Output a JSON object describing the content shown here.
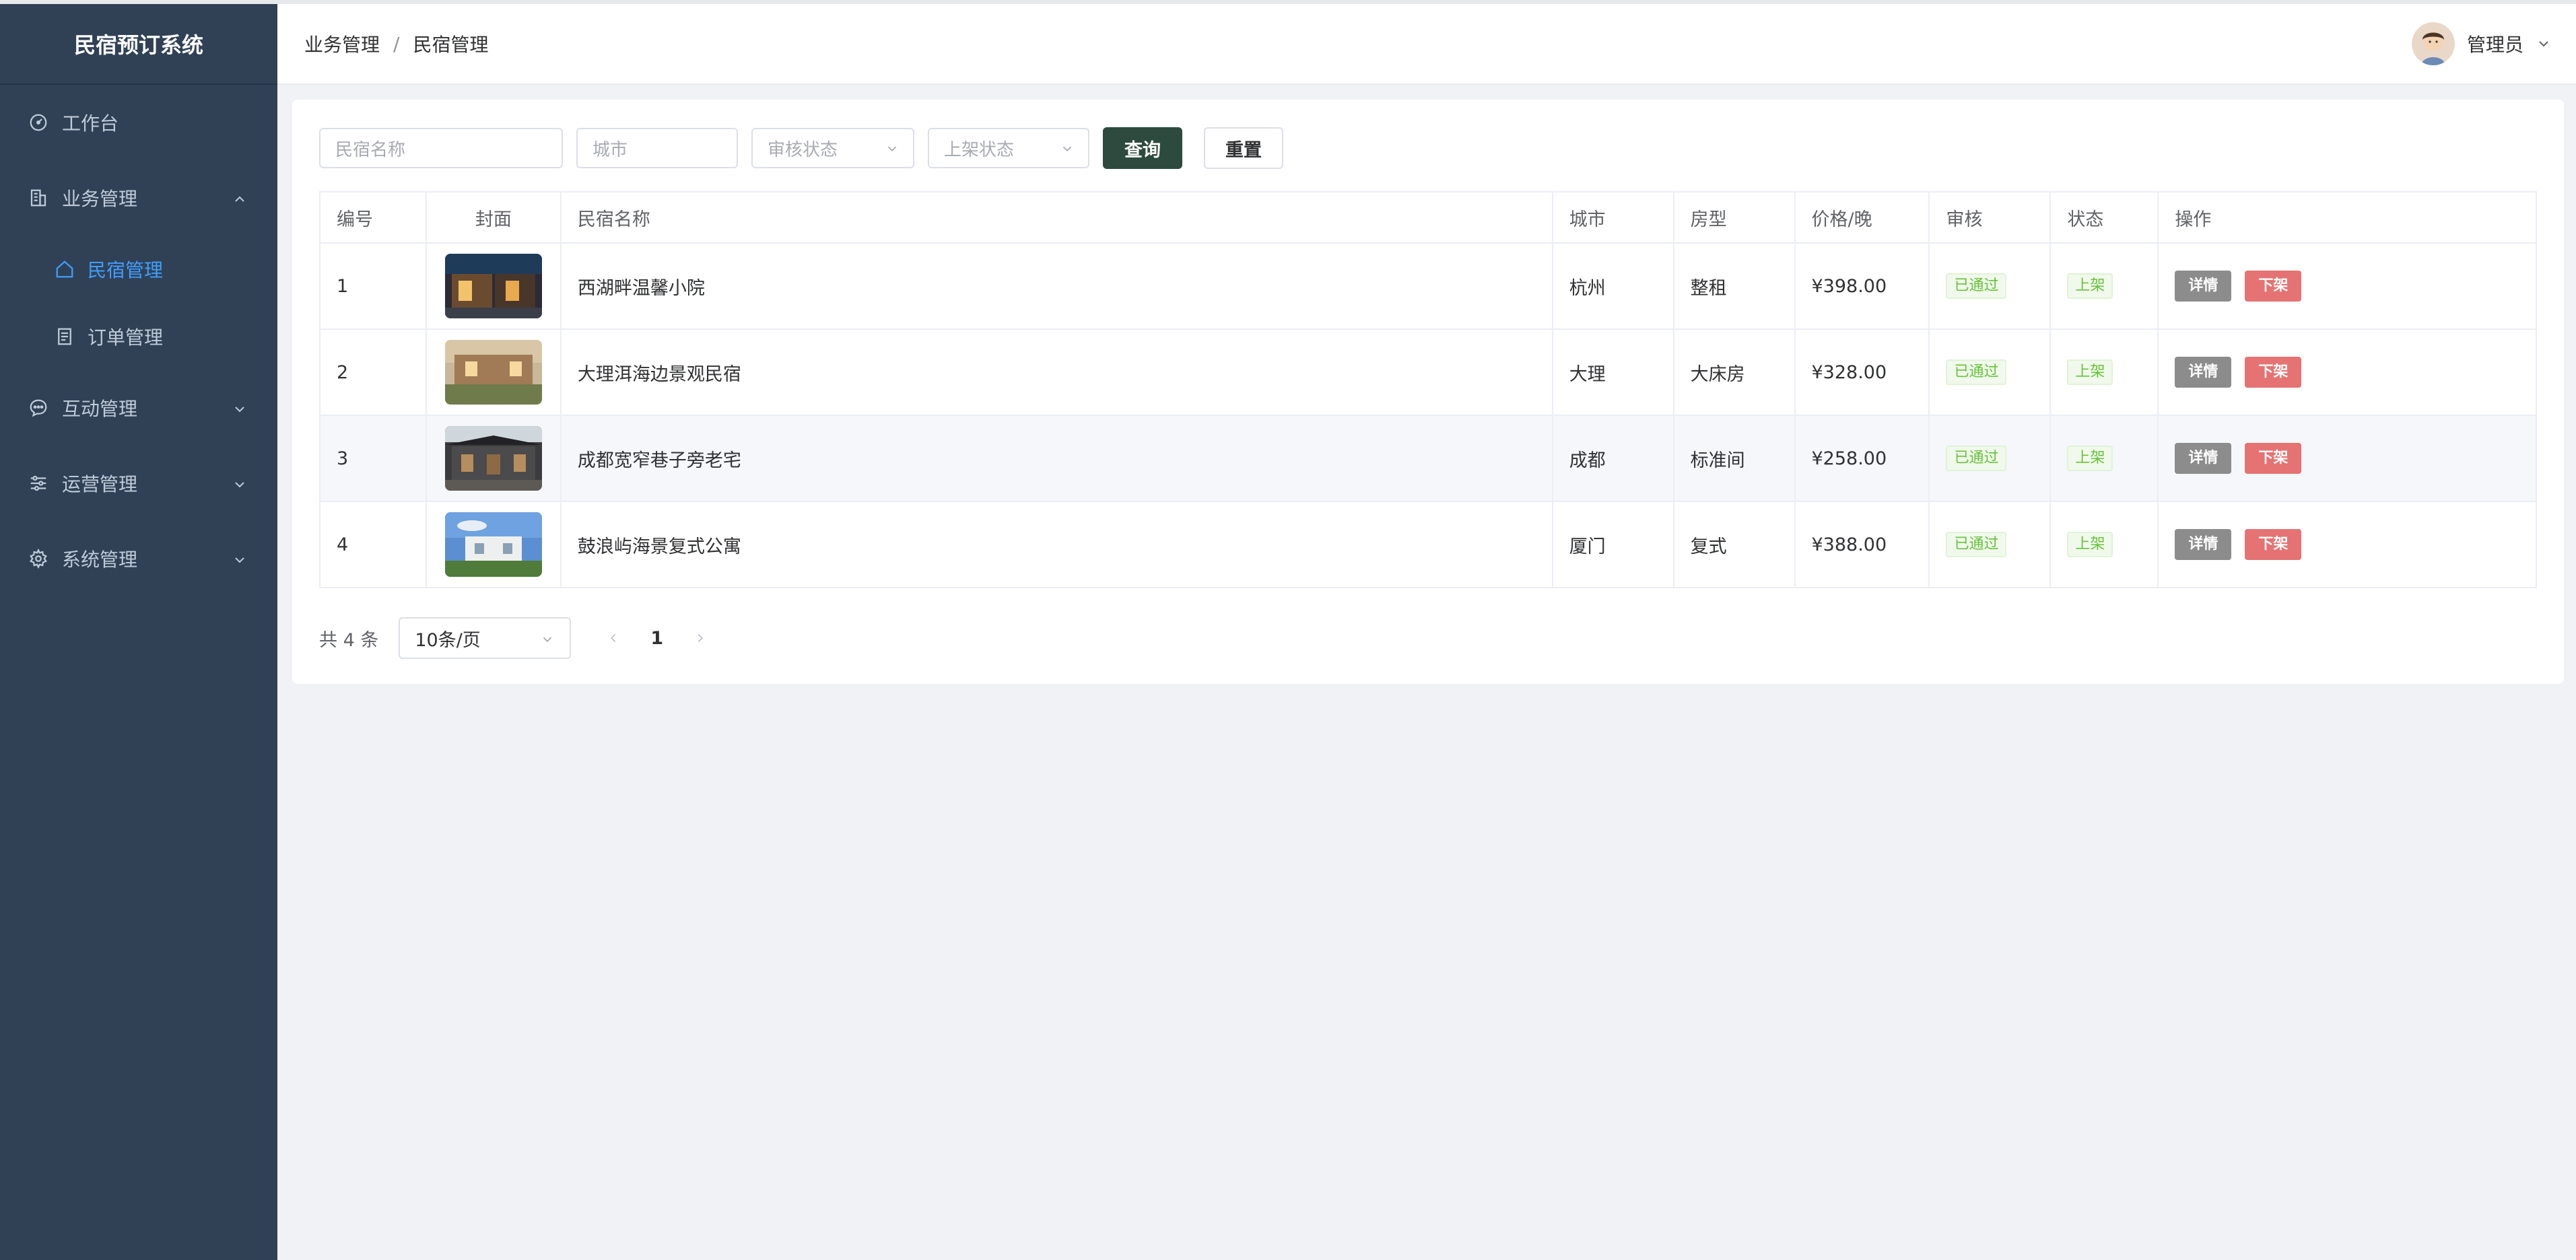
{
  "app": {
    "title": "民宿预订系统"
  },
  "sidebar": {
    "items": [
      {
        "label": "工作台",
        "icon": "dashboard-icon"
      },
      {
        "label": "业务管理",
        "icon": "building-icon",
        "expanded": true,
        "children": [
          {
            "label": "民宿管理",
            "icon": "home-icon",
            "active": true
          },
          {
            "label": "订单管理",
            "icon": "document-icon"
          }
        ]
      },
      {
        "label": "互动管理",
        "icon": "chat-icon"
      },
      {
        "label": "运营管理",
        "icon": "sliders-icon"
      },
      {
        "label": "系统管理",
        "icon": "gear-icon"
      }
    ]
  },
  "header": {
    "breadcrumb": [
      "业务管理",
      "民宿管理"
    ],
    "separator": "/",
    "user": "管理员"
  },
  "filters": {
    "name_placeholder": "民宿名称",
    "city_placeholder": "城市",
    "audit_placeholder": "审核状态",
    "shelf_placeholder": "上架状态",
    "search_label": "查询",
    "reset_label": "重置"
  },
  "table": {
    "columns": [
      "编号",
      "封面",
      "民宿名称",
      "城市",
      "房型",
      "价格/晚",
      "审核",
      "状态",
      "操作"
    ],
    "rows": [
      {
        "id": "1",
        "name": "西湖畔温馨小院",
        "city": "杭州",
        "room": "整租",
        "price": "¥398.00",
        "audit": "已通过",
        "status": "上架"
      },
      {
        "id": "2",
        "name": "大理洱海边景观民宿",
        "city": "大理",
        "room": "大床房",
        "price": "¥328.00",
        "audit": "已通过",
        "status": "上架"
      },
      {
        "id": "3",
        "name": "成都宽窄巷子旁老宅",
        "city": "成都",
        "room": "标准间",
        "price": "¥258.00",
        "audit": "已通过",
        "status": "上架"
      },
      {
        "id": "4",
        "name": "鼓浪屿海景复式公寓",
        "city": "厦门",
        "room": "复式",
        "price": "¥388.00",
        "audit": "已通过",
        "status": "上架"
      }
    ],
    "actions": {
      "detail": "详情",
      "offline": "下架"
    }
  },
  "pagination": {
    "total": "共 4 条",
    "page_size": "10条/页",
    "current_page": "1"
  },
  "colors": {
    "sidebar_bg": "#304156",
    "active_menu": "#409eff",
    "primary_button": "#2d4a3e",
    "tag_green": "#67c23a",
    "offline_button": "#e57373",
    "detail_button": "#8c8c8c"
  }
}
